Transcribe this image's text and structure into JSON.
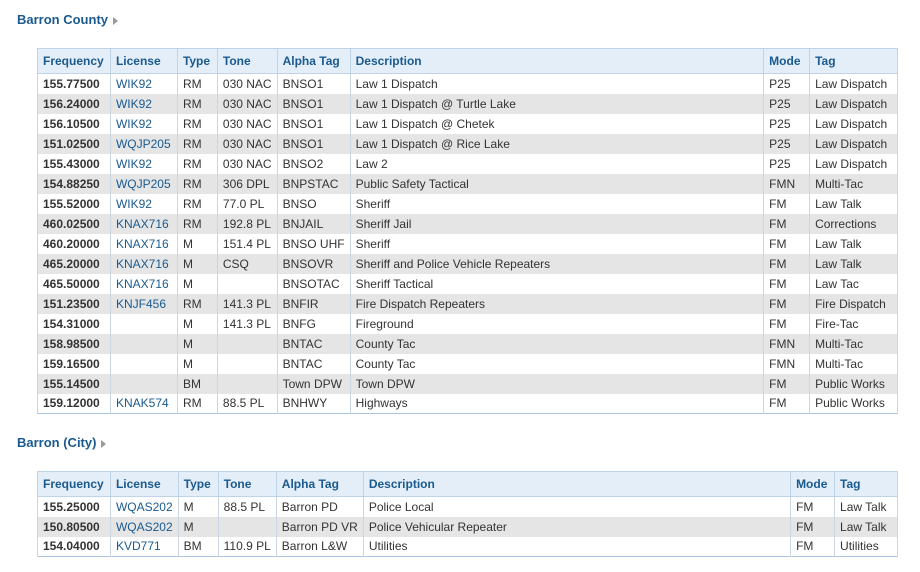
{
  "columns": [
    "Frequency",
    "License",
    "Type",
    "Tone",
    "Alpha Tag",
    "Description",
    "Mode",
    "Tag"
  ],
  "sections": [
    {
      "title": "Barron County",
      "rows": [
        [
          "155.77500",
          "WIK92",
          "RM",
          "030 NAC",
          "BNSO1",
          "Law 1 Dispatch",
          "P25",
          "Law Dispatch"
        ],
        [
          "156.24000",
          "WIK92",
          "RM",
          "030 NAC",
          "BNSO1",
          "Law 1 Dispatch @ Turtle Lake",
          "P25",
          "Law Dispatch"
        ],
        [
          "156.10500",
          "WIK92",
          "RM",
          "030 NAC",
          "BNSO1",
          "Law 1 Dispatch @ Chetek",
          "P25",
          "Law Dispatch"
        ],
        [
          "151.02500",
          "WQJP205",
          "RM",
          "030 NAC",
          "BNSO1",
          "Law 1 Dispatch @ Rice Lake",
          "P25",
          "Law Dispatch"
        ],
        [
          "155.43000",
          "WIK92",
          "RM",
          "030 NAC",
          "BNSO2",
          "Law 2",
          "P25",
          "Law Dispatch"
        ],
        [
          "154.88250",
          "WQJP205",
          "RM",
          "306 DPL",
          "BNPSTAC",
          "Public Safety Tactical",
          "FMN",
          "Multi-Tac"
        ],
        [
          "155.52000",
          "WIK92",
          "RM",
          "77.0 PL",
          "BNSO",
          "Sheriff",
          "FM",
          "Law Talk"
        ],
        [
          "460.02500",
          "KNAX716",
          "RM",
          "192.8 PL",
          "BNJAIL",
          "Sheriff Jail",
          "FM",
          "Corrections"
        ],
        [
          "460.20000",
          "KNAX716",
          "M",
          "151.4 PL",
          "BNSO UHF",
          "Sheriff",
          "FM",
          "Law Talk"
        ],
        [
          "465.20000",
          "KNAX716",
          "M",
          "CSQ",
          "BNSOVR",
          "Sheriff and Police Vehicle Repeaters",
          "FM",
          "Law Talk"
        ],
        [
          "465.50000",
          "KNAX716",
          "M",
          "",
          "BNSOTAC",
          "Sheriff Tactical",
          "FM",
          "Law Tac"
        ],
        [
          "151.23500",
          "KNJF456",
          "RM",
          "141.3 PL",
          "BNFIR",
          "Fire Dispatch Repeaters",
          "FM",
          "Fire Dispatch"
        ],
        [
          "154.31000",
          "",
          "M",
          "141.3 PL",
          "BNFG",
          "Fireground",
          "FM",
          "Fire-Tac"
        ],
        [
          "158.98500",
          "",
          "M",
          "",
          "BNTAC",
          "County Tac",
          "FMN",
          "Multi-Tac"
        ],
        [
          "159.16500",
          "",
          "M",
          "",
          "BNTAC",
          "County Tac",
          "FMN",
          "Multi-Tac"
        ],
        [
          "155.14500",
          "",
          "BM",
          "",
          "Town DPW",
          "Town DPW",
          "FM",
          "Public Works"
        ],
        [
          "159.12000",
          "KNAK574",
          "RM",
          "88.5 PL",
          "BNHWY",
          "Highways",
          "FM",
          "Public Works"
        ]
      ]
    },
    {
      "title": "Barron (City)",
      "rows": [
        [
          "155.25000",
          "WQAS202",
          "M",
          "88.5 PL",
          "Barron PD",
          "Police Local",
          "FM",
          "Law Talk"
        ],
        [
          "150.80500",
          "WQAS202",
          "M",
          "",
          "Barron PD VR",
          "Police Vehicular Repeater",
          "FM",
          "Law Talk"
        ],
        [
          "154.04000",
          "KVD771",
          "BM",
          "110.9 PL",
          "Barron L&W",
          "Utilities",
          "FM",
          "Utilities"
        ]
      ]
    }
  ]
}
